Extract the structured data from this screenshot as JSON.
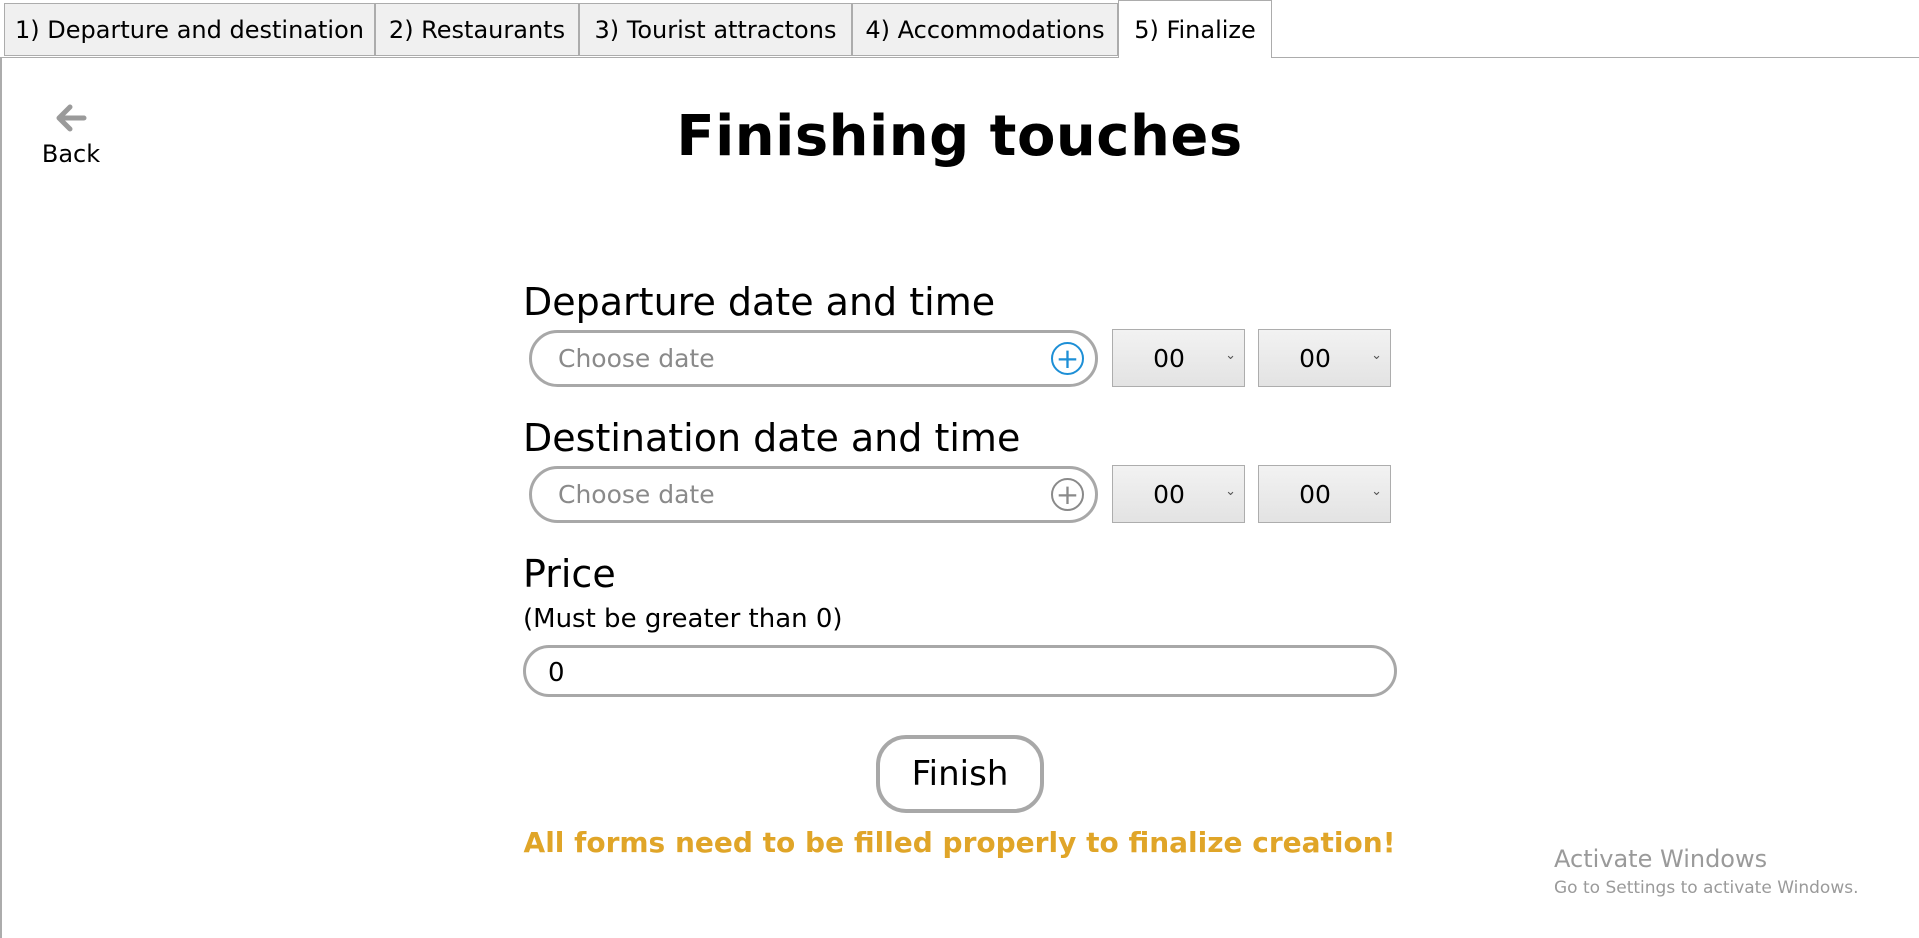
{
  "tabs": [
    {
      "label": "1) Departure and destination"
    },
    {
      "label": "2) Restaurants"
    },
    {
      "label": "3) Tourist attractons"
    },
    {
      "label": "4) Accommodations"
    },
    {
      "label": "5) Finalize",
      "active": true
    }
  ],
  "back": {
    "label": "Back",
    "icon": "arrow-left-icon"
  },
  "page_title": "Finishing touches",
  "departure": {
    "label": "Departure date and time",
    "date_placeholder": "Choose date",
    "hour": "00",
    "minute": "00"
  },
  "destination": {
    "label": "Destination date and time",
    "date_placeholder": "Choose date",
    "hour": "00",
    "minute": "00"
  },
  "price": {
    "label": "Price",
    "hint": "(Must be greater than 0)",
    "value": "0"
  },
  "finish_label": "Finish",
  "warning": "All forms need to be filled properly to finalize creation!",
  "watermark": {
    "title": "Activate Windows",
    "subtitle": "Go to Settings to activate Windows."
  },
  "colors": {
    "warning": "#e0a528",
    "focus_accent": "#1d8fd6",
    "border": "#a8a8a8"
  }
}
